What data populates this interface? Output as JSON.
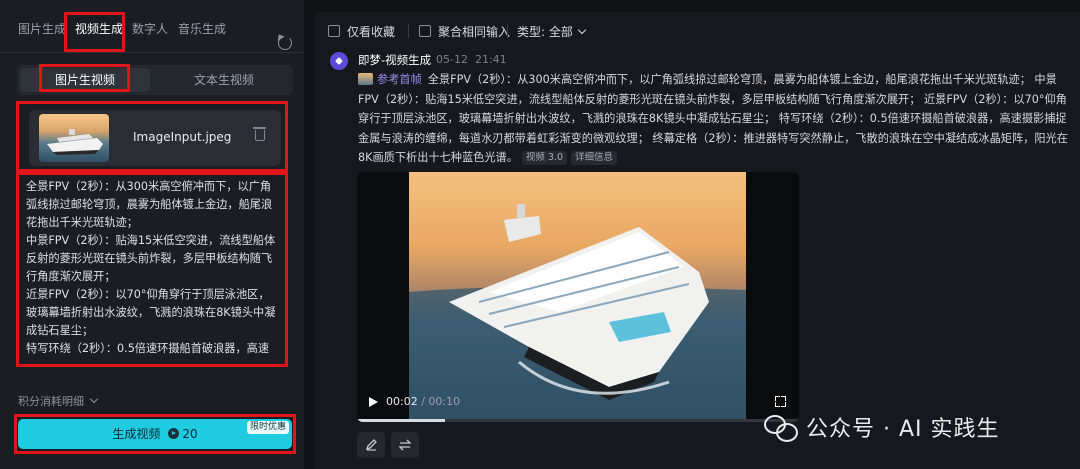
{
  "left_panel": {
    "tabs": [
      "图片生成",
      "视频生成",
      "数字人",
      "音乐生成"
    ],
    "active_tab": "视频生成",
    "mode_tabs": [
      "图片生视频",
      "文本生视频"
    ],
    "active_mode": "图片生视频",
    "image_input": {
      "filename": "ImageInput.jpeg"
    },
    "prompt_lines": [
      "全景FPV（2秒）：从300米高空俯冲而下，以广角",
      "弧线掠过邮轮穹顶，晨雾为船体镀上金边，船尾浪",
      "花拖出千米光斑轨迹；",
      "中景FPV（2秒）：贴海15米低空突进，流线型船体",
      "反射的菱形光斑在镜头前炸裂，多层甲板结构随飞",
      "行角度渐次展开；",
      "近景FPV（2秒）：以70°仰角穿行于顶层泳池区，",
      "玻璃幕墙折射出水波纹，飞溅的浪珠在8K镜头中凝",
      "成钻石星尘；",
      "特写环绕（2秒）：0.5倍速环摄船首破浪器，高速"
    ],
    "credits_label": "积分消耗明细",
    "generate_button": {
      "label": "生成视频",
      "cost": "20",
      "promo": "限时优惠"
    }
  },
  "right_panel": {
    "toolbar": {
      "favorites_only": "仅看收藏",
      "aggregate_inputs": "聚合相同输入",
      "type_filter": "类型: 全部"
    },
    "message": {
      "title": "即梦-视频生成",
      "date": "05-12",
      "time": "21:41",
      "ref_label": "参考首帧",
      "text": "全景FPV（2秒）：从300米高空俯冲而下，以广角弧线掠过邮轮穹顶，晨雾为船体镀上金边，船尾浪花拖出千米光斑轨迹； 中景FPV（2秒）：贴海15米低空突进，流线型船体反射的菱形光斑在镜头前炸裂，多层甲板结构随飞行角度渐次展开； 近景FPV（2秒）：以70°仰角穿行于顶层泳池区，玻璃幕墙折射出水波纹，飞溅的浪珠在8K镜头中凝成钻石星尘； 特写环绕（2秒）：0.5倍速环摄船首破浪器，高速摄影捕捉金属与浪涛的缠绵，每道水刃都带着虹彩渐变的微观纹理； 终幕定格（2秒）：推进器特写突然静止，飞散的浪珠在空中凝结成冰晶矩阵，阳光在8K画质下析出十七种蓝色光谱。",
      "model_tag": "视频 3.0",
      "details_tag": "详细信息"
    },
    "player": {
      "current": "00:02",
      "duration": "00:10",
      "progress": 0.2
    }
  },
  "watermark": {
    "text": "公众号 · AI 实践生"
  },
  "colors": {
    "accent": "#1fcbe0",
    "highlight_box": "#e0161b",
    "ref_label": "#9e8cf0"
  }
}
